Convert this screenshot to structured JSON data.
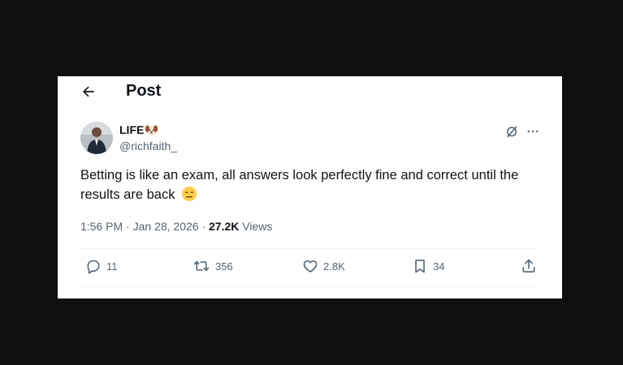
{
  "header": {
    "title": "Post",
    "back_icon": "arrow-left-icon"
  },
  "author": {
    "display_name": "LIFE",
    "badge_icon": "dog-face-icon",
    "handle": "@richfaith_"
  },
  "tweet": {
    "text": "Betting is like an exam, all answers look perfectly fine and correct until the results are back",
    "emoji_icon": "expressionless-face-icon",
    "time": "1:56 PM",
    "date": "Jan 28, 2026",
    "views_count": "27.2K",
    "views_label": "Views"
  },
  "actions": {
    "replies": "11",
    "reposts": "356",
    "likes": "2.8K",
    "bookmarks": "34"
  },
  "colors": {
    "text": "#0f1419",
    "muted": "#536471",
    "divider": "#eff3f4"
  }
}
